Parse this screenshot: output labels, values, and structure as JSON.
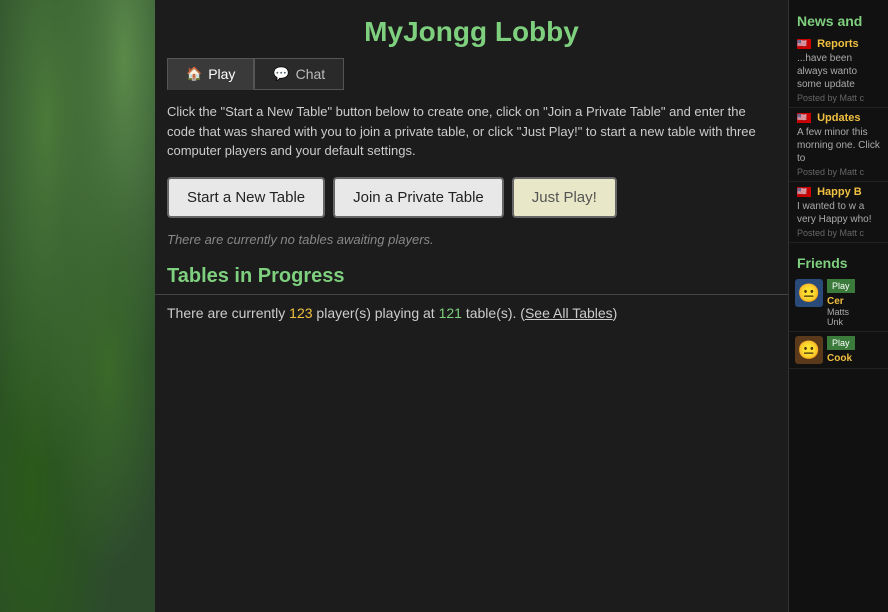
{
  "page": {
    "title": "MyJongg Lobby"
  },
  "tabs": [
    {
      "id": "play",
      "label": "Play",
      "icon": "🏠",
      "active": true
    },
    {
      "id": "chat",
      "label": "Chat",
      "icon": "💬",
      "active": false
    }
  ],
  "description": "Click the \"Start a New Table\" button below to create one, click on \"Join a Private Table\" and enter the code that was shared with you to join a private table, or click \"Just Play!\" to start a new table with three computer players and your default settings.",
  "buttons": {
    "start_new_table": "Start a New Table",
    "join_private_table": "Join a Private Table",
    "just_play": "Just Play!"
  },
  "no_tables_message": "There are currently no tables awaiting players.",
  "tables_in_progress": {
    "heading": "Tables in Progress",
    "player_count": "123",
    "table_count": "121",
    "text_before_players": "There are currently ",
    "text_players_suffix": " player(s) playing at ",
    "text_tables_suffix": " table(s). (",
    "see_all_label": "See All Tables",
    "text_end": ")"
  },
  "sidebar": {
    "news_title": "News and",
    "items": [
      {
        "id": "reports",
        "flag": "🇺🇸",
        "title": "Reports",
        "text": "...have been always wanto some update",
        "posted": "Posted by Matt c"
      },
      {
        "id": "updates",
        "flag": "🇺🇸",
        "title": "Updates",
        "text": "A few minor this morning one. Click to",
        "posted": "Posted by Matt c"
      },
      {
        "id": "happy-b",
        "flag": "🇺🇸",
        "title": "Happy B",
        "text": "I wanted to w a very Happy who!",
        "posted": "Posted by Matt c"
      }
    ],
    "friends_title": "Friends",
    "friends": [
      {
        "id": "friend-1",
        "name": "Cer",
        "status": "Matts",
        "status2": "Unk",
        "avatar_color": "blue",
        "play_label": "Play"
      },
      {
        "id": "friend-2",
        "name": "Cook",
        "status": "",
        "avatar_color": "brown",
        "play_label": "Play"
      }
    ]
  }
}
